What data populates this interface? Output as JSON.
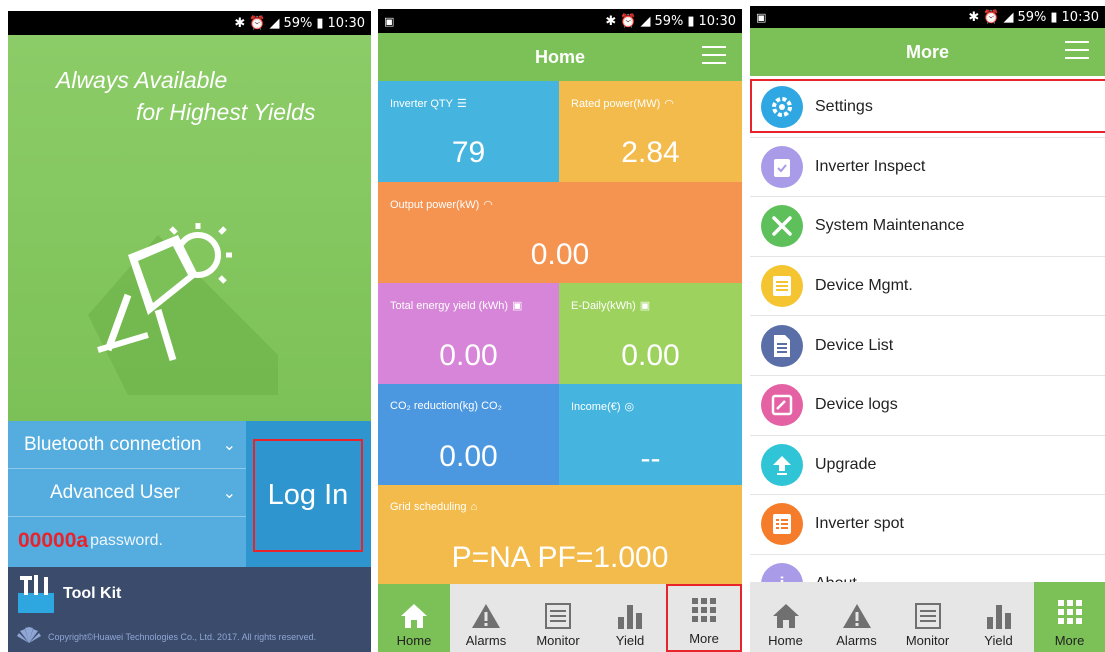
{
  "status": {
    "battery": "59%",
    "time_p1": "10:30",
    "time_p2": "10:30",
    "time_p3": "10:30"
  },
  "login_screen": {
    "slogan_line1": "Always Available",
    "slogan_line2": "for Highest Yields",
    "connection_label": "Bluetooth connection",
    "user_label": "Advanced User",
    "password_value": "00000a",
    "password_placeholder": "password.",
    "login_button": "Log In",
    "toolkit_label": "Tool Kit",
    "copyright": "Copyright©Huawei Technologies Co., Ltd. 2017. All rights reserved."
  },
  "home_screen": {
    "title": "Home",
    "tiles": {
      "inverter_qty": {
        "label": "Inverter QTY",
        "value": "79",
        "color": "#45b5e0"
      },
      "rated_power": {
        "label": "Rated power(MW)",
        "value": "2.84",
        "color": "#f3bb4b"
      },
      "output_power": {
        "label": "Output power(kW)",
        "value": "0.00",
        "color": "#f59350"
      },
      "total_energy": {
        "label": "Total energy yield (kWh)",
        "value": "0.00",
        "color": "#d685d8"
      },
      "e_daily": {
        "label": "E-Daily(kWh)",
        "value": "0.00",
        "color": "#9ed25f"
      },
      "co2": {
        "label": "CO₂ reduction(kg) CO₂",
        "value": "0.00",
        "color": "#4b97e0"
      },
      "income": {
        "label": "Income(€)",
        "value": "--",
        "color": "#45b5e0"
      },
      "grid": {
        "label": "Grid scheduling",
        "value": "P=NA PF=1.000",
        "color": "#f3bb4b"
      }
    }
  },
  "more_screen": {
    "title": "More",
    "items": [
      {
        "label": "Settings",
        "color": "#2fa7e2",
        "icon": "gear-icon"
      },
      {
        "label": "Inverter Inspect",
        "color": "#a99be8",
        "icon": "clipboard-icon"
      },
      {
        "label": "System Maintenance",
        "color": "#5dc05a",
        "icon": "wrench-icon"
      },
      {
        "label": "Device Mgmt.",
        "color": "#f4c531",
        "icon": "list-icon"
      },
      {
        "label": "Device List",
        "color": "#5a6fa8",
        "icon": "document-icon"
      },
      {
        "label": "Device logs",
        "color": "#e461a4",
        "icon": "log-icon"
      },
      {
        "label": "Upgrade",
        "color": "#2fc4d6",
        "icon": "upload-arrow-icon"
      },
      {
        "label": "Inverter spot",
        "color": "#f57c2a",
        "icon": "checklist-icon"
      },
      {
        "label": "About",
        "color": "#a99be8",
        "icon": "info-icon"
      }
    ]
  },
  "tabs": [
    "Home",
    "Alarms",
    "Monitor",
    "Yield",
    "More"
  ]
}
